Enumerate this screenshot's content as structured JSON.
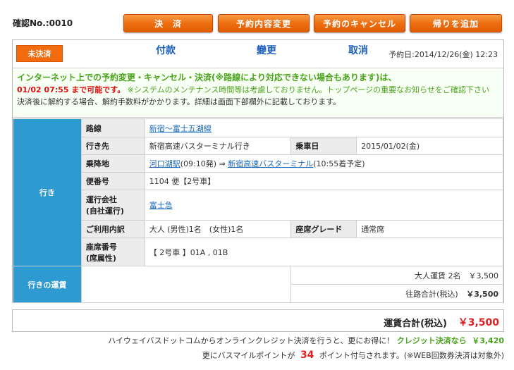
{
  "header": {
    "confirmation_no": "確認No.:0010"
  },
  "buttons": {
    "pay": "決　済",
    "change": "予約内容変更",
    "cancel": "予約のキャンセル",
    "add_return": "帰りを追加"
  },
  "status": {
    "badge": "未決済",
    "col_pay": "付款",
    "col_change": "變更",
    "col_cancel": "取消",
    "reserved_at": "予約日:2014/12/26(金) 12:23"
  },
  "notice": {
    "line1": "インターネット上での予約変更・キャンセル・決済(※路線により対応できない場合もあります)は、",
    "deadline": "01/02 07:55 まで可能です。",
    "line2_note": "※システムのメンテナンス時間等は考慮しておりません。トップページの重要なお知らせをご確認下さい",
    "line3": "決済後に解約する場合、解約手数料がかかります。詳細は画面下部欄外に記載しております。"
  },
  "trip": {
    "section_label": "行き",
    "route_label": "路線",
    "route_value": "新宿〜富士五湖線",
    "destination_label": "行き先",
    "destination_value": "新宿高速バスターミナル行き",
    "boarding_date_label": "乗車日",
    "boarding_date_value": "2015/01/02(金)",
    "stops_label": "乗降地",
    "stop_from": "河口湖駅",
    "stop_from_time": "(09:10発) ⇒",
    "stop_to": "新宿高速バスターミナル",
    "stop_to_time": "(10:55着予定)",
    "bus_no_label": "便番号",
    "bus_no_value": "1104 便【2号車】",
    "operator_label_1": "運行会社",
    "operator_label_2": "(自社運行)",
    "operator_value": "富士急",
    "breakdown_label": "ご利用内訳",
    "breakdown_value": "大人 (男性)1名　(女性)1名",
    "grade_label": "座席グレード",
    "grade_value": "通常席",
    "seat_label_1": "座席番号",
    "seat_label_2": "(席属性)",
    "seat_value": "【 2号車 】01A , 01B"
  },
  "fare": {
    "section_label": "行きの運賃",
    "adult_fare": "大人運賃 2名　￥3,500",
    "return_total_label": "往路合計(税込)",
    "return_total_value": "￥3,500"
  },
  "total": {
    "label": "運賃合計(税込)",
    "value": "￥3,500"
  },
  "credit": {
    "text": "ハイウェイバスドットコムからオンラインクレジット決済を行うと、更にお得に！",
    "highlight": "クレジット決済なら",
    "amount": "￥3,420"
  },
  "mile": {
    "text_before": "更にバスマイルポイントが",
    "points": "34",
    "text_after": "ポイント付与されます。(※WEB回数券決済は対象外)"
  },
  "colors": {
    "orange_button": "#ec6c0e",
    "section_blue": "#2d9ad2",
    "notice_green": "#4aa31c",
    "price_red": "#e02020"
  }
}
